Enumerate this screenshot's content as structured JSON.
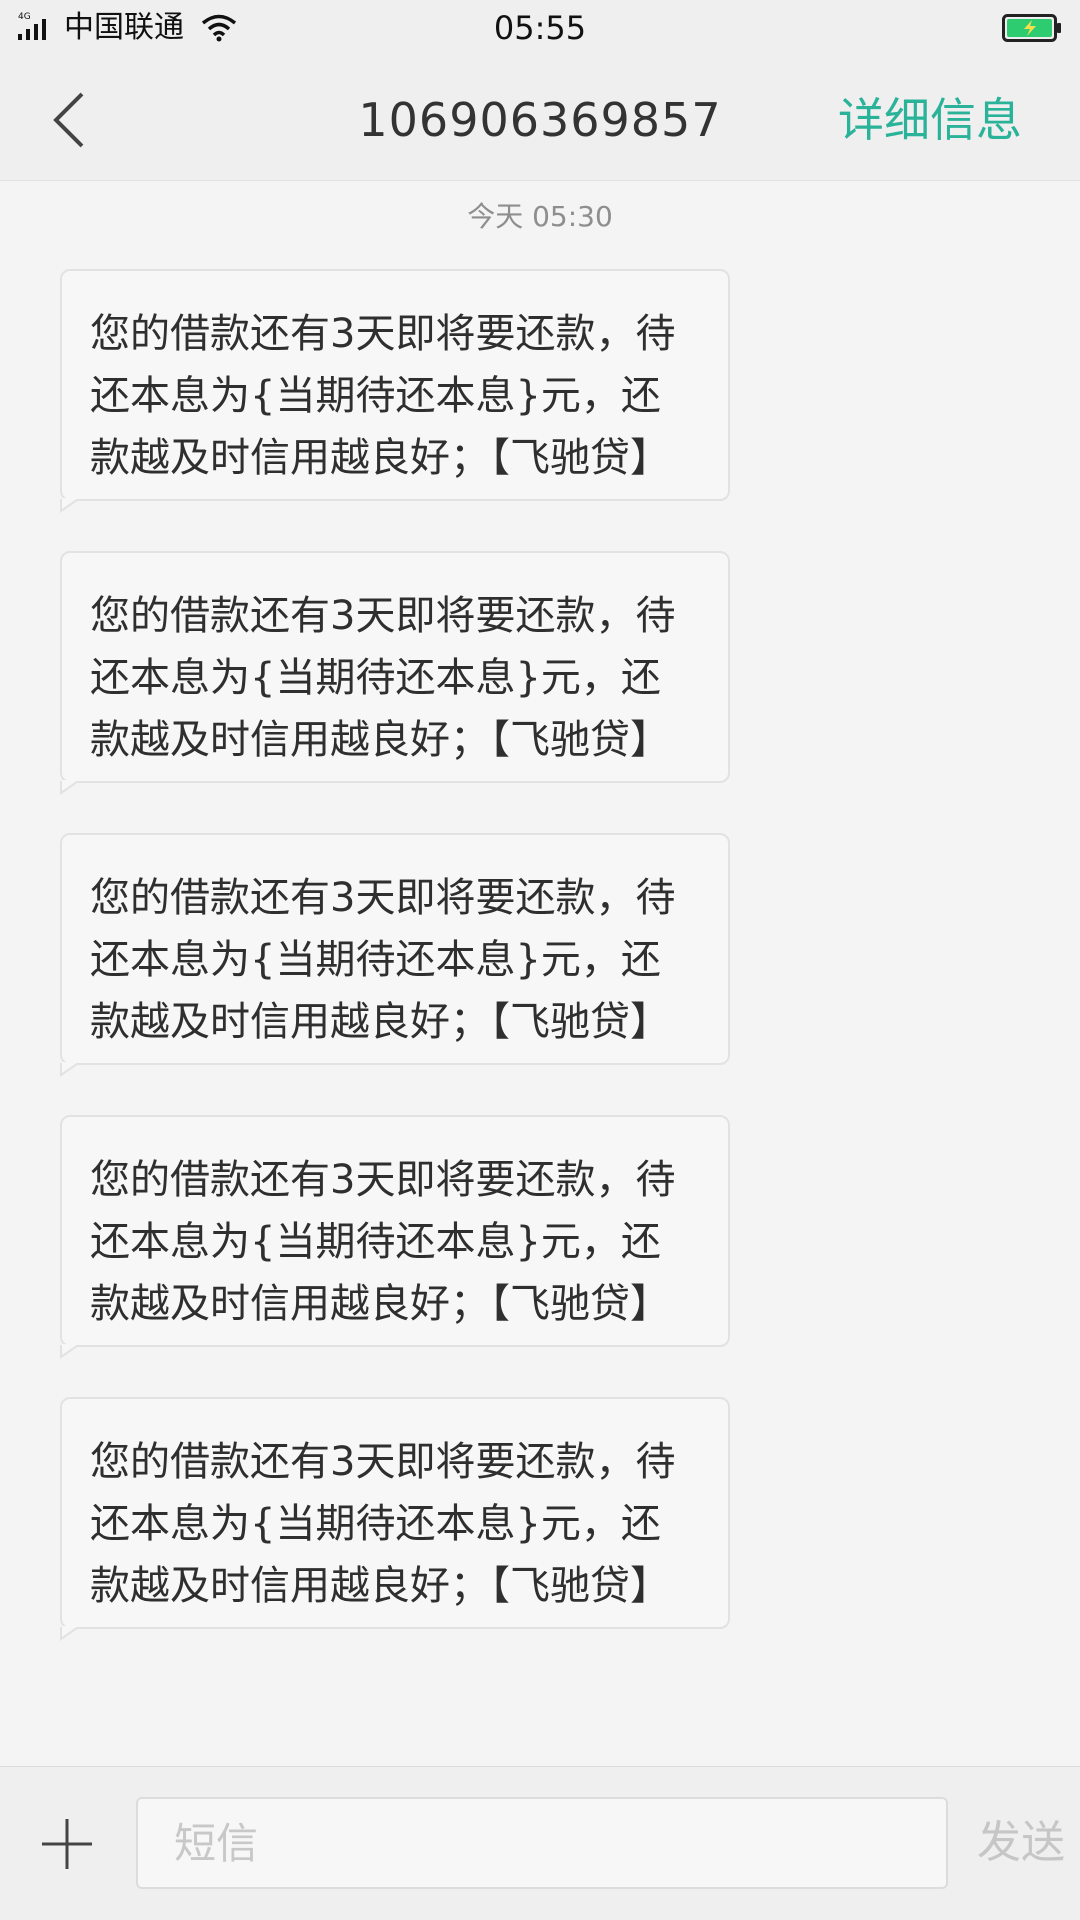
{
  "status_bar": {
    "network_type": "4G",
    "carrier": "中国联通",
    "time": "05:55",
    "signal_icon": "signal-bars-icon",
    "wifi_icon": "wifi-icon",
    "battery_icon": "battery-charging-icon",
    "battery_color": "#2ecc71"
  },
  "header": {
    "back_icon": "chevron-left-icon",
    "title": "106906369857",
    "details_label": "详细信息",
    "accent_color": "#2bb39a"
  },
  "conversation": {
    "timestamp": "今天  05:30",
    "messages": [
      {
        "text": "您的借款还有3天即将要还款，待还本息为{当期待还本息}元，还款越及时信用越良好；【飞驰贷】"
      },
      {
        "text": "您的借款还有3天即将要还款，待还本息为{当期待还本息}元，还款越及时信用越良好；【飞驰贷】"
      },
      {
        "text": "您的借款还有3天即将要还款，待还本息为{当期待还本息}元，还款越及时信用越良好；【飞驰贷】"
      },
      {
        "text": "您的借款还有3天即将要还款，待还本息为{当期待还本息}元，还款越及时信用越良好；【飞驰贷】"
      },
      {
        "text": "您的借款还有3天即将要还款，待还本息为{当期待还本息}元，还款越及时信用越良好；【飞驰贷】"
      }
    ]
  },
  "compose": {
    "add_icon": "plus-icon",
    "placeholder": "短信",
    "send_label": "发送"
  }
}
